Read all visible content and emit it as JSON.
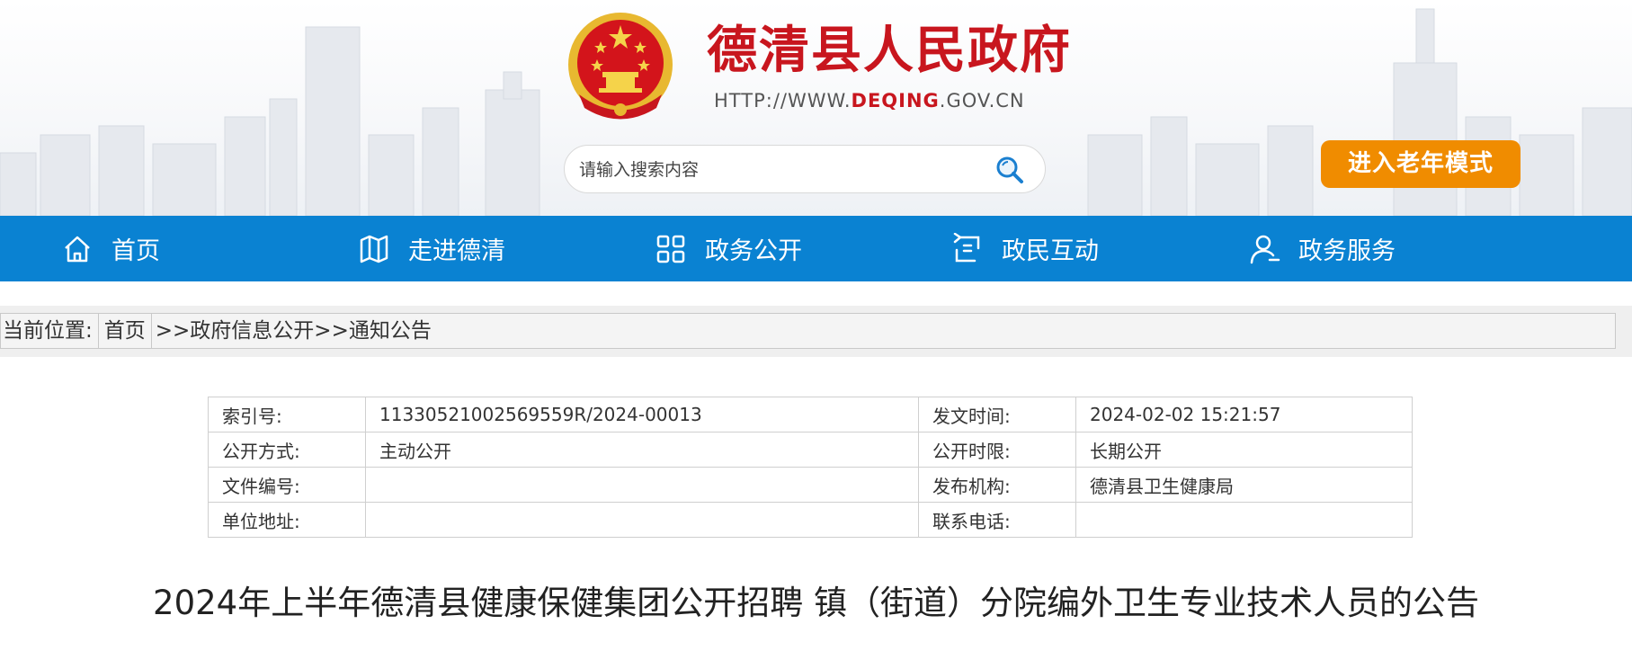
{
  "header": {
    "site_title": "德清县人民政府",
    "site_url_prefix": "HTTP://WWW.",
    "site_url_highlight": "DEQING",
    "site_url_suffix": ".GOV.CN",
    "search_placeholder": "请输入搜索内容",
    "search_icon": "search-icon",
    "elder_mode_label": "进入老年模式"
  },
  "nav": [
    {
      "label": "首页",
      "icon": "home-icon"
    },
    {
      "label": "走进德清",
      "icon": "map-icon"
    },
    {
      "label": "政务公开",
      "icon": "grid-icon"
    },
    {
      "label": "政民互动",
      "icon": "interaction-icon"
    },
    {
      "label": "政务服务",
      "icon": "user-icon"
    }
  ],
  "breadcrumb": {
    "prefix": "当前位置:",
    "home": "首页",
    "sep1": ">>",
    "section": "政府信息公开",
    "sep2": ">>",
    "current": "通知公告"
  },
  "meta": [
    {
      "k1": "索引号:",
      "v1": "11330521002569559R/2024-00013",
      "k2": "发文时间:",
      "v2": "2024-02-02 15:21:57"
    },
    {
      "k1": "公开方式:",
      "v1": "主动公开",
      "k2": "公开时限:",
      "v2": "长期公开"
    },
    {
      "k1": "文件编号:",
      "v1": "",
      "k2": "发布机构:",
      "v2": "德清县卫生健康局"
    },
    {
      "k1": "单位地址:",
      "v1": "",
      "k2": "联系电话:",
      "v2": ""
    }
  ],
  "article": {
    "title": "2024年上半年德清县健康保健集团公开招聘 镇（街道）分院编外卫生专业技术人员的公告"
  },
  "colors": {
    "brand_red": "#c8161e",
    "nav_blue": "#0a82d2",
    "elder_orange": "#f08c00"
  }
}
